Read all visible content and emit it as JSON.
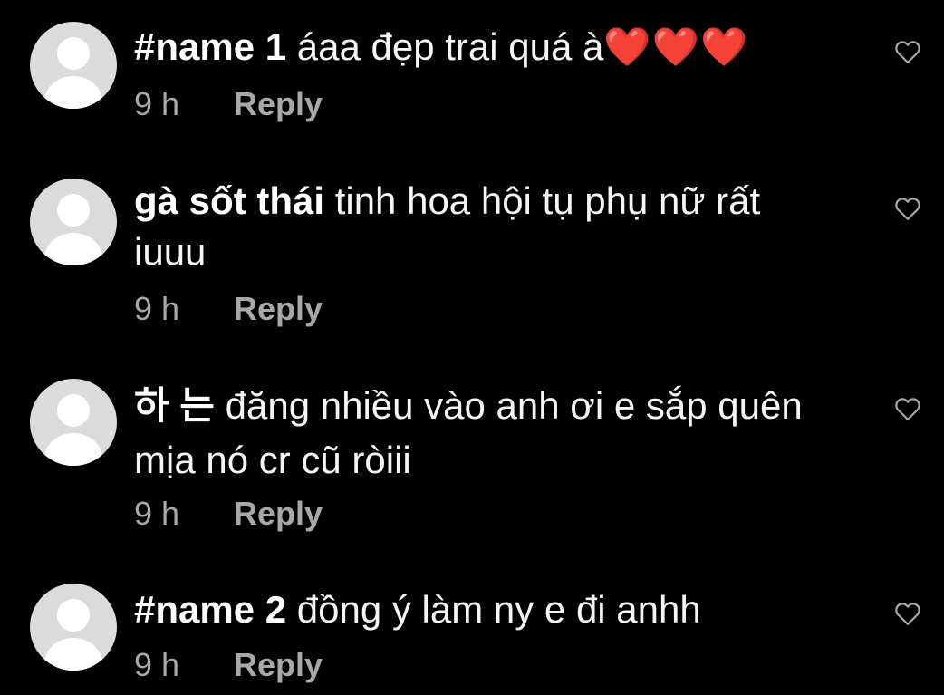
{
  "comments": [
    {
      "username": "#name 1",
      "text": " áaa đẹp trai quá à",
      "emoji": "❤️❤️❤️",
      "time": "9 h",
      "reply_label": "Reply"
    },
    {
      "username": "gà sốt thái",
      "text": " tinh hoa hội tụ phụ nữ rất iuuu",
      "emoji": "",
      "time": "9 h",
      "reply_label": "Reply"
    },
    {
      "username": "하 는",
      "text": " đăng nhiều vào anh ơi e sắp quên mịa nó cr cũ ròiii",
      "emoji": "",
      "time": "9 h",
      "reply_label": "Reply"
    },
    {
      "username": "#name 2",
      "text": " đồng ý làm ny e đi anhh",
      "emoji": "",
      "time": "9 h",
      "reply_label": "Reply"
    }
  ],
  "icons": {
    "like": "heart-outline-icon",
    "avatar": "default-avatar"
  },
  "colors": {
    "background": "#000000",
    "text": "#f5f5f5",
    "secondary": "#a8a8a8",
    "avatar": "#dbdbdb",
    "heart_emoji": "#e0242c"
  }
}
